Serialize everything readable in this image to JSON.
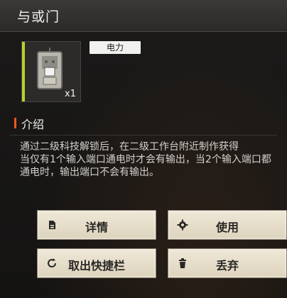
{
  "window": {
    "title": "与或门"
  },
  "item": {
    "quantity": "x1",
    "category_tag": "电力",
    "icon": "logic-gate-device-icon",
    "accent_color": "#b7d12a"
  },
  "section": {
    "title": "介绍"
  },
  "description": {
    "line1": "通过二级科技解锁后，在二级工作台附近制作获得",
    "line2": "当仅有1个输入端口通电时才会有输出，当2个输入端口都通电时，输出端口不会有输出。"
  },
  "buttons": {
    "details": {
      "label": "详情",
      "icon": "document-icon"
    },
    "use": {
      "label": "使用",
      "icon": "gear-icon"
    },
    "remove_hotbar": {
      "label": "取出快捷栏",
      "icon": "refresh-icon"
    },
    "discard": {
      "label": "丢弃",
      "icon": "trash-icon"
    }
  }
}
